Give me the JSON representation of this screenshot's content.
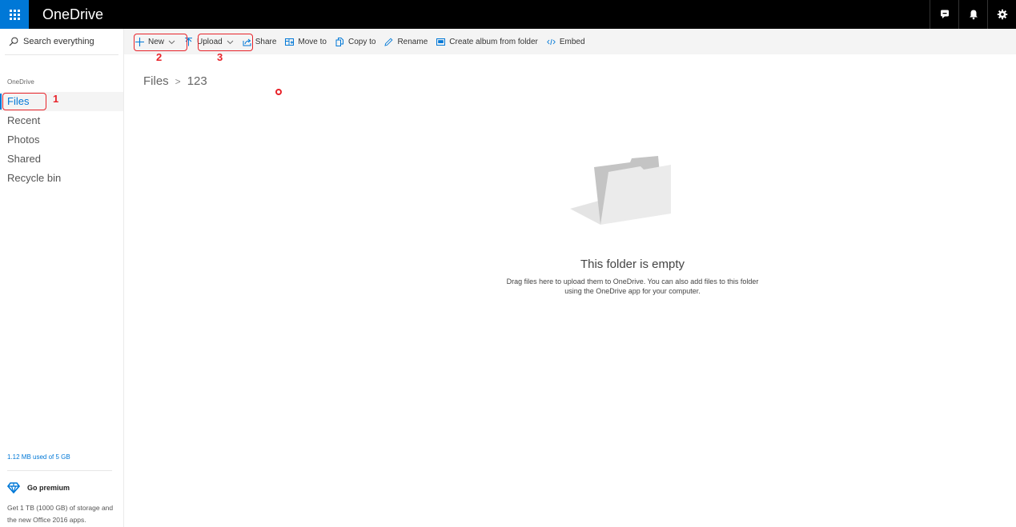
{
  "topbar": {
    "app_title": "OneDrive",
    "icons": [
      "feedback-icon",
      "notifications-bell-icon",
      "settings-gear-icon"
    ],
    "brand_color": "#0078d7"
  },
  "sidebar": {
    "search_placeholder": "Search everything",
    "section_label": "OneDrive",
    "items": [
      {
        "label": "Files",
        "active": true
      },
      {
        "label": "Recent",
        "active": false
      },
      {
        "label": "Photos",
        "active": false
      },
      {
        "label": "Shared",
        "active": false
      },
      {
        "label": "Recycle bin",
        "active": false
      }
    ],
    "storage_text": "1.12 MB used of 5 GB",
    "premium": {
      "label": "Go premium",
      "description": "Get 1 TB (1000 GB) of storage and the new Office 2016 apps."
    }
  },
  "commandbar": {
    "new_label": "New",
    "upload_label": "Upload",
    "share_label": "Share",
    "move_to_label": "Move to",
    "copy_to_label": "Copy to",
    "rename_label": "Rename",
    "create_album_label": "Create album from folder",
    "embed_label": "Embed"
  },
  "breadcrumb": {
    "root": "Files",
    "separator": ">",
    "current": "123"
  },
  "empty_state": {
    "title": "This folder is empty",
    "description": "Drag files here to upload them to OneDrive. You can also add files to this folder using the OneDrive app for your computer."
  },
  "annotations": {
    "step1": "1",
    "step2": "2",
    "step3": "3",
    "color": "#e8232a"
  }
}
